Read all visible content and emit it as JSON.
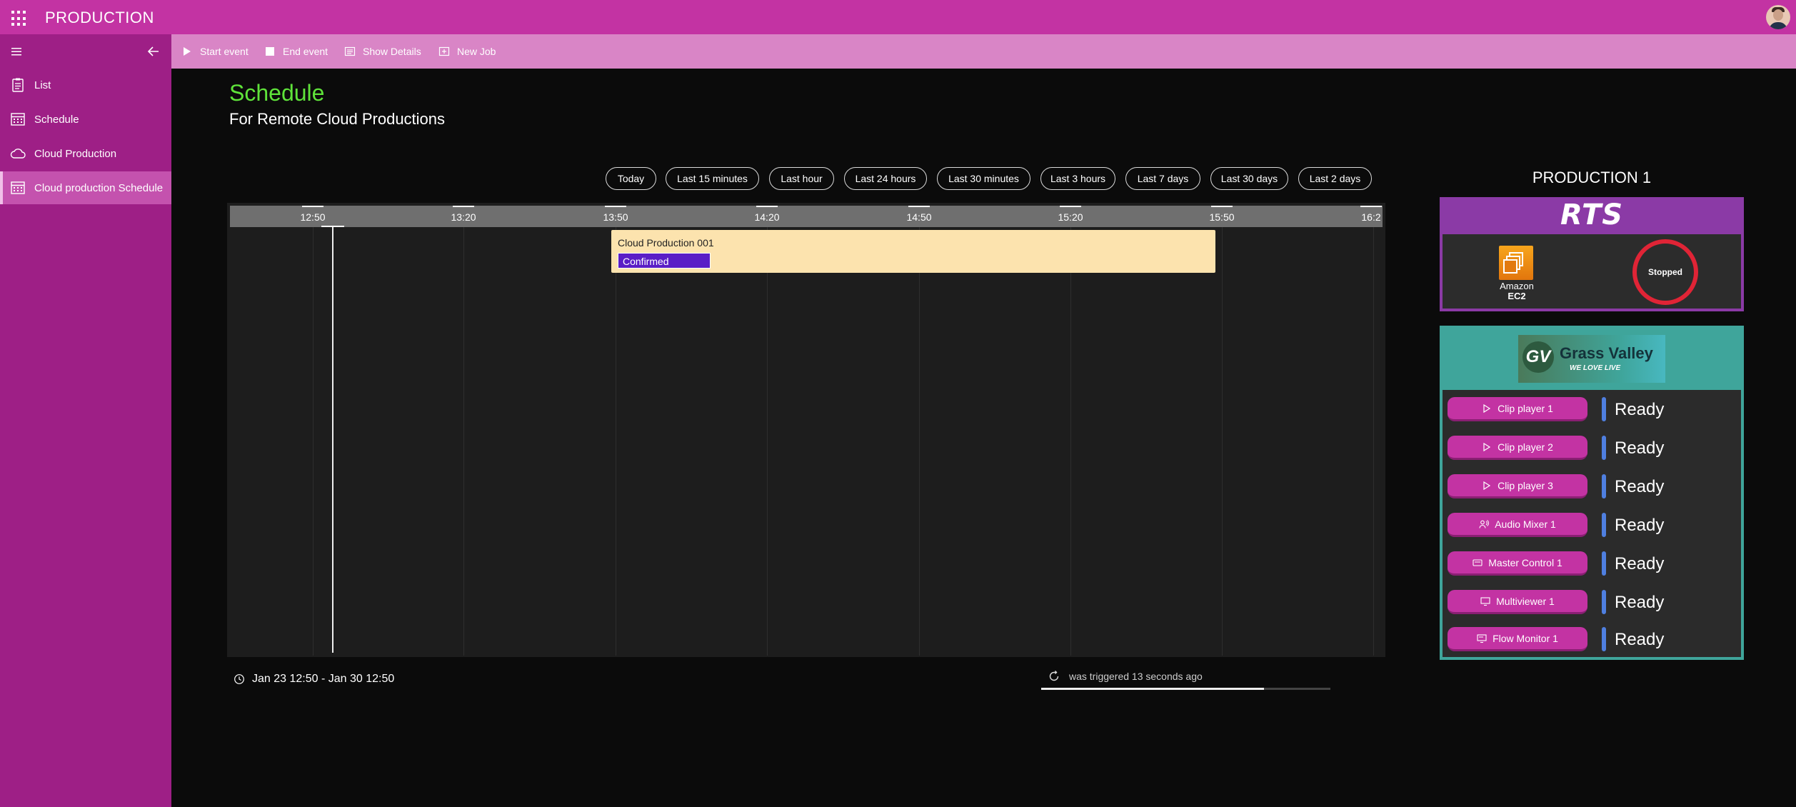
{
  "app": {
    "title": "PRODUCTION"
  },
  "sidebar": {
    "items": [
      {
        "label": "List",
        "icon": "clipboard-icon"
      },
      {
        "label": "Schedule",
        "icon": "calendar-icon"
      },
      {
        "label": "Cloud Production",
        "icon": "cloud-icon"
      },
      {
        "label": "Cloud production Schedule",
        "icon": "calendar-icon",
        "active": true
      }
    ]
  },
  "commandbar": {
    "start_event": "Start event",
    "end_event": "End event",
    "show_details": "Show Details",
    "new_job": "New Job"
  },
  "main": {
    "title": "Schedule",
    "subtitle": "For Remote Cloud Productions",
    "ranges": [
      "Today",
      "Last 15 minutes",
      "Last hour",
      "Last 24 hours",
      "Last 30 minutes",
      "Last 3 hours",
      "Last 7 days",
      "Last 30 days",
      "Last 2 days"
    ],
    "timeline": {
      "ticks": [
        "12:50",
        "13:20",
        "13:50",
        "14:20",
        "14:50",
        "15:20",
        "15:50",
        "16:2"
      ],
      "event": {
        "name": "Cloud Production 001",
        "status": "Confirmed"
      }
    },
    "date_range": "Jan 23 12:50 - Jan 30 12:50",
    "trigger_text": "was triggered 13 seconds ago",
    "refresh_progress": 0.77
  },
  "panel": {
    "title": "PRODUCTION 1",
    "rts": {
      "logo": "RTS",
      "ec2_line1": "Amazon",
      "ec2_line2": "EC2",
      "status": "Stopped",
      "status_color": "#e02436"
    },
    "gv": {
      "logo_mark": "GV",
      "logo_name": "Grass Valley",
      "logo_tag": "WE LOVE LIVE",
      "devices": [
        {
          "label": "Clip player 1",
          "icon": "play-icon",
          "status": "Ready"
        },
        {
          "label": "Clip player 2",
          "icon": "play-icon",
          "status": "Ready"
        },
        {
          "label": "Clip player 3",
          "icon": "play-icon",
          "status": "Ready"
        },
        {
          "label": "Audio Mixer 1",
          "icon": "people-audio-icon",
          "status": "Ready"
        },
        {
          "label": "Master Control 1",
          "icon": "card-icon",
          "status": "Ready"
        },
        {
          "label": "Multiviewer 1",
          "icon": "monitor-icon",
          "status": "Ready"
        },
        {
          "label": "Flow Monitor 1",
          "icon": "monitor-flow-icon",
          "status": "Ready"
        }
      ]
    }
  },
  "colors": {
    "topbar": "#c333a3",
    "sidebar": "#9e1f86",
    "commandbar": "#d985c6",
    "title_green": "#5fe33a",
    "event_bg": "#fce3ae",
    "confirmed": "#5a1ec6",
    "status_bar": "#4f7fe0"
  }
}
